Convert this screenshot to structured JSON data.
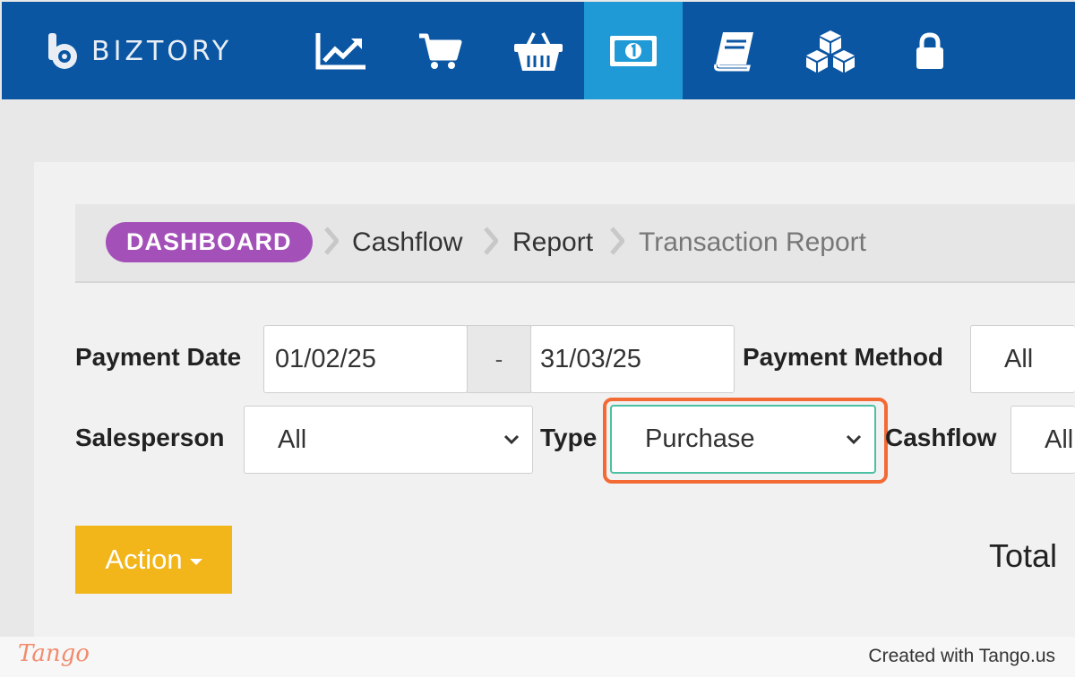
{
  "app": {
    "brand": "BIZTORY"
  },
  "nav": {
    "items": [
      {
        "name": "reports-chart-icon"
      },
      {
        "name": "cart-icon"
      },
      {
        "name": "basket-icon"
      },
      {
        "name": "cash-icon",
        "active": true
      },
      {
        "name": "book-icon"
      },
      {
        "name": "boxes-icon"
      },
      {
        "name": "lock-icon"
      }
    ]
  },
  "breadcrumb": {
    "home": "DASHBOARD",
    "items": [
      "Cashflow",
      "Report",
      "Transaction Report"
    ]
  },
  "filters": {
    "payment_date_label": "Payment Date",
    "date_from": "01/02/25",
    "date_sep": "-",
    "date_to": "31/03/25",
    "payment_method_label": "Payment Method",
    "payment_method_value": "All",
    "salesperson_label": "Salesperson",
    "salesperson_value": "All",
    "type_label": "Type",
    "type_value": "Purchase",
    "cashflow_label": "Cashflow",
    "cashflow_value": "All"
  },
  "toolbar": {
    "action_label": "Action",
    "total_label": "Total"
  },
  "footer": {
    "logo": "Tango",
    "created": "Created with Tango.us"
  },
  "colors": {
    "nav_bg": "#0a56a3",
    "nav_active": "#1f9ad7",
    "home_badge": "#a450b9",
    "action_btn": "#f2b51a",
    "highlight": "#f36a35"
  }
}
